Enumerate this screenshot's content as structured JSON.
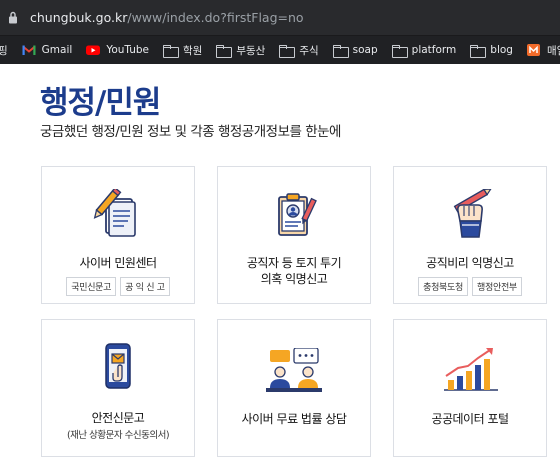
{
  "browser": {
    "url_host": "chungbuk.go.kr",
    "url_path": "/www/index.do?firstFlag=no",
    "bookmarks": [
      {
        "label": "",
        "icon": "truncated-icon"
      },
      {
        "label": "Gmail",
        "icon": "gmail-icon"
      },
      {
        "label": "YouTube",
        "icon": "youtube-icon"
      },
      {
        "label": "학원",
        "icon": "folder-icon"
      },
      {
        "label": "부동산",
        "icon": "folder-icon"
      },
      {
        "label": "주식",
        "icon": "folder-icon"
      },
      {
        "label": "soap",
        "icon": "folder-icon"
      },
      {
        "label": "platform",
        "icon": "folder-icon"
      },
      {
        "label": "blog",
        "icon": "folder-icon"
      },
      {
        "label": "매일경제",
        "icon": "maeil-icon"
      }
    ],
    "first_bookmark_partial": "핑"
  },
  "page": {
    "title": "행정/민원",
    "subtitle": "궁금했던 행정/민원 정보 및 각종 행정공개정보를 한눈에"
  },
  "cards": [
    {
      "label": "사이버 민원센터",
      "chips": [
        "국민신문고",
        "공 익 신 고"
      ],
      "icon": "pen-document-icon"
    },
    {
      "label": "공직자 등 토지 투기",
      "label2": "의혹 익명신고",
      "icon": "clipboard-person-icon"
    },
    {
      "label": "공직비리 익명신고",
      "chips": [
        "충청북도청",
        "행정안전부"
      ],
      "icon": "hand-pen-icon"
    },
    {
      "label": "안전신문고",
      "sub": "(재난 상황문자 수신동의서)",
      "icon": "phone-message-icon"
    },
    {
      "label": "사이버 무료 법률 상담",
      "icon": "consultation-icon"
    },
    {
      "label": "공공데이터 포털",
      "icon": "bar-chart-icon"
    }
  ],
  "colors": {
    "title": "#1c3c8c",
    "accent_orange": "#f5a623",
    "accent_navy": "#2b4a9e"
  }
}
